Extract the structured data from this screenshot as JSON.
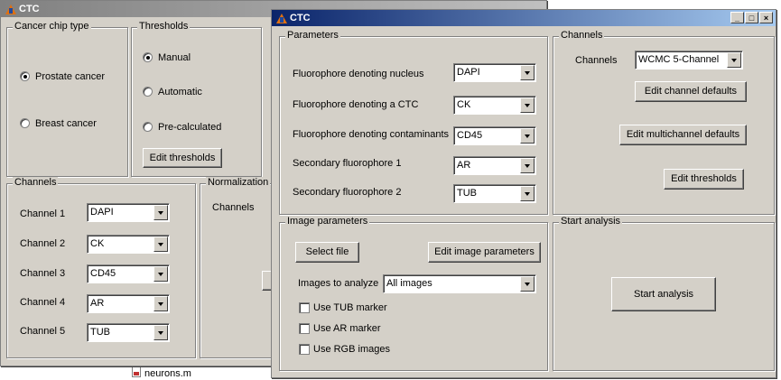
{
  "background": {
    "file_name": "neurons.m"
  },
  "back_window": {
    "title": "CTC",
    "cancer_chip": {
      "title": "Cancer chip type",
      "options": [
        {
          "label": "Prostate cancer",
          "selected": true
        },
        {
          "label": "Breast cancer",
          "selected": false
        }
      ]
    },
    "thresholds": {
      "title": "Thresholds",
      "options": [
        {
          "label": "Manual",
          "selected": true
        },
        {
          "label": "Automatic",
          "selected": false
        },
        {
          "label": "Pre-calculated",
          "selected": false
        }
      ],
      "edit_button": "Edit thresholds"
    },
    "channels": {
      "title": "Channels",
      "rows": [
        {
          "label": "Channel 1",
          "value": "DAPI"
        },
        {
          "label": "Channel 2",
          "value": "CK"
        },
        {
          "label": "Channel 3",
          "value": "CD45"
        },
        {
          "label": "Channel 4",
          "value": "AR"
        },
        {
          "label": "Channel 5",
          "value": "TUB"
        }
      ]
    },
    "normalization": {
      "title": "Normalization",
      "channels_label": "Channels"
    }
  },
  "front_window": {
    "title": "CTC",
    "parameters": {
      "title": "Parameters",
      "rows": [
        {
          "label": "Fluorophore denoting nucleus",
          "value": "DAPI"
        },
        {
          "label": "Fluorophore denoting a CTC",
          "value": "CK"
        },
        {
          "label": "Fluorophore denoting contaminants",
          "value": "CD45"
        },
        {
          "label": "Secondary fluorophore 1",
          "value": "AR"
        },
        {
          "label": "Secondary fluorophore 2",
          "value": "TUB"
        }
      ]
    },
    "channels": {
      "title": "Channels",
      "label": "Channels",
      "value": "WCMC 5-Channel",
      "edit_channel_defaults": "Edit channel defaults",
      "edit_multichannel_defaults": "Edit multichannel defaults",
      "edit_thresholds": "Edit thresholds"
    },
    "image_parameters": {
      "title": "Image parameters",
      "select_file": "Select file",
      "edit_image_parameters": "Edit image parameters",
      "images_to_analyze_label": "Images to analyze",
      "images_to_analyze_value": "All images",
      "checkboxes": [
        {
          "label": "Use TUB marker",
          "checked": false
        },
        {
          "label": "Use AR marker",
          "checked": false
        },
        {
          "label": "Use RGB images",
          "checked": false
        }
      ]
    },
    "start_analysis": {
      "title": "Start analysis",
      "button": "Start analysis"
    }
  }
}
